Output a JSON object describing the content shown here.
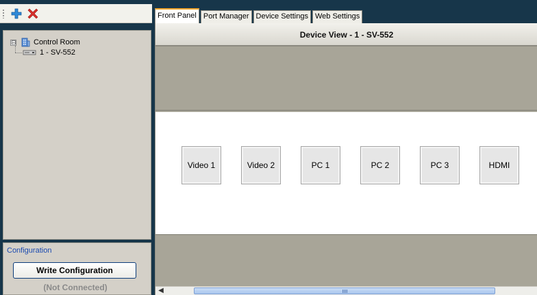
{
  "toolbar": {
    "add_icon": "plus-icon",
    "remove_icon": "x-icon",
    "colors": {
      "add": "#2e8ad8",
      "remove": "#d9302c"
    }
  },
  "tree": {
    "root": {
      "expander": "⊟",
      "label": "Control Room",
      "icon": "building-icon"
    },
    "children": [
      {
        "label": "1 - SV-552",
        "icon": "device-icon"
      }
    ]
  },
  "config": {
    "title": "Configuration",
    "write_button": "Write Configuration",
    "status": "(Not Connected)"
  },
  "tabs": [
    {
      "label": "Front Panel",
      "active": true
    },
    {
      "label": "Port Manager",
      "active": false
    },
    {
      "label": "Device Settings",
      "active": false
    },
    {
      "label": "Web Settings",
      "active": false
    }
  ],
  "device_view": {
    "title": "Device View - 1 - SV-552",
    "inputs": [
      "Video 1",
      "Video 2",
      "PC 1",
      "PC 2",
      "PC 3",
      "HDMI"
    ]
  },
  "colors": {
    "frame": "#17364a",
    "panel_gray": "#a8a598",
    "tab_accent": "#f2a62b",
    "config_title": "#1c4bb0"
  }
}
